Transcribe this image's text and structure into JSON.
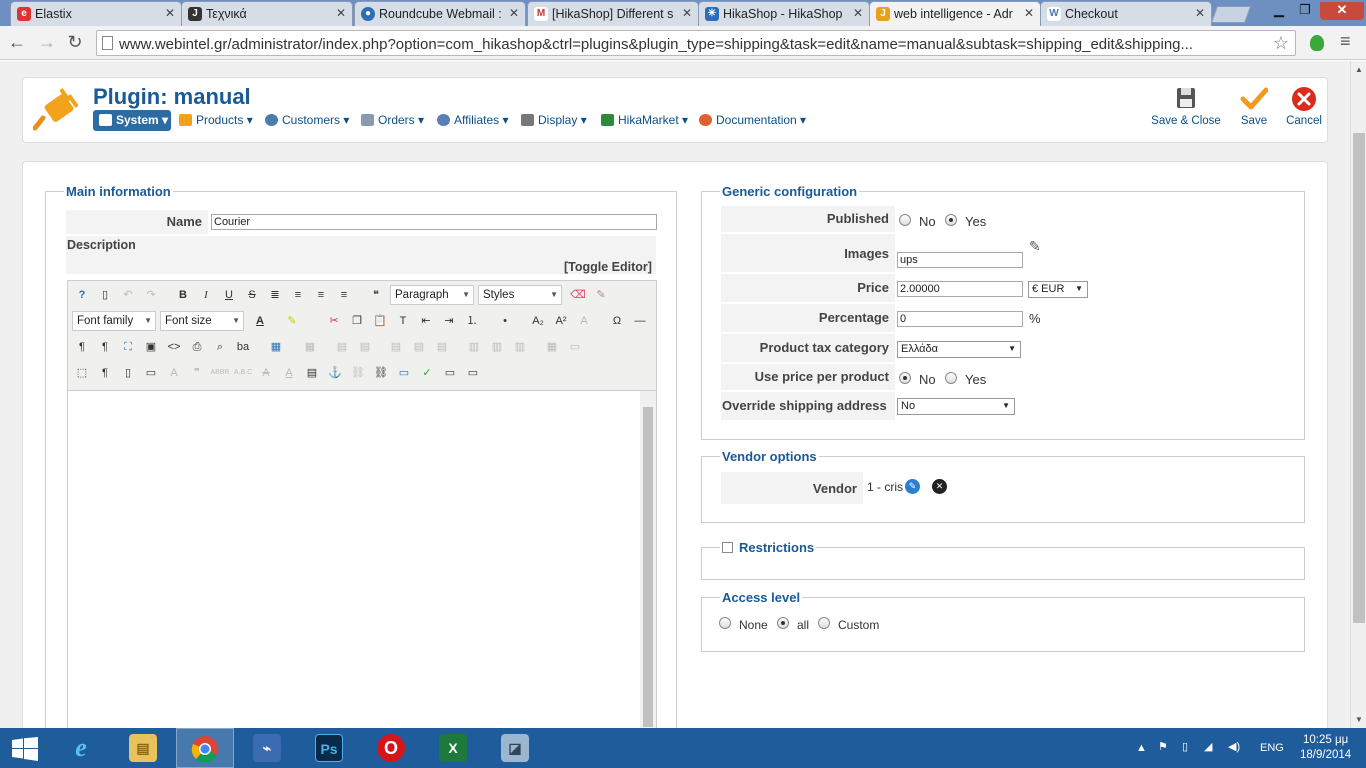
{
  "browser": {
    "tabs": [
      {
        "title": "Elastix",
        "favicon": "elastix-icon",
        "color": "#d33"
      },
      {
        "title": "Τεχνικά",
        "favicon": "joomla-icon",
        "color": "#333"
      },
      {
        "title": "Roundcube Webmail :",
        "favicon": "roundcube-icon",
        "color": "#2a6fb8"
      },
      {
        "title": "[HikaShop] Different s",
        "favicon": "gmail-icon",
        "color": "#c33"
      },
      {
        "title": "HikaShop - HikaShop",
        "favicon": "hikashop-icon",
        "color": "#2a6fb8"
      },
      {
        "title": "web intelligence - Adr",
        "favicon": "joomla-icon",
        "color": "#e8a020"
      },
      {
        "title": "Checkout",
        "favicon": "checkout-icon",
        "color": "#4a7cb0"
      }
    ],
    "url": "www.webintel.gr/administrator/index.php?option=com_hikashop&ctrl=plugins&plugin_type=shipping&task=edit&name=manual&subtask=shipping_edit&shipping..."
  },
  "header": {
    "title": "Plugin: manual",
    "menu": [
      {
        "label": "System",
        "icon": "system-icon",
        "color": "#fff"
      },
      {
        "label": "Products",
        "icon": "products-icon",
        "color": "#f2a21b"
      },
      {
        "label": "Customers",
        "icon": "customers-icon",
        "color": "#4a7cb0"
      },
      {
        "label": "Orders",
        "icon": "orders-icon",
        "color": "#8a9bb0"
      },
      {
        "label": "Affiliates",
        "icon": "affiliates-icon",
        "color": "#5b7fb5"
      },
      {
        "label": "Display",
        "icon": "display-icon",
        "color": "#777"
      },
      {
        "label": "HikaMarket",
        "icon": "hikamarket-icon",
        "color": "#2e8b3a"
      },
      {
        "label": "Documentation",
        "icon": "documentation-icon",
        "color": "#e06030"
      }
    ],
    "actions": {
      "save_close": "Save & Close",
      "save": "Save",
      "cancel": "Cancel"
    }
  },
  "main_info": {
    "legend": "Main information",
    "name_label": "Name",
    "name_value": "Courier",
    "description_label": "Description",
    "toggle_editor": "[Toggle Editor]",
    "editor": {
      "format_select": "Paragraph",
      "styles_select": "Styles",
      "font_family": "Font family",
      "font_size": "Font size"
    }
  },
  "generic": {
    "legend": "Generic configuration",
    "published_label": "Published",
    "published_value": "Yes",
    "no": "No",
    "yes": "Yes",
    "images_label": "Images",
    "images_value": "ups",
    "price_label": "Price",
    "price_value": "2.00000",
    "currency": "€ EUR",
    "percentage_label": "Percentage",
    "percentage_value": "0",
    "percent_sign": "%",
    "tax_label": "Product tax category",
    "tax_value": "Ελλάδα",
    "per_product_label": "Use price per product",
    "per_product_value": "No",
    "override_label": "Override shipping address",
    "override_value": "No"
  },
  "vendor": {
    "legend": "Vendor options",
    "label": "Vendor",
    "value": "1 - cris"
  },
  "restrictions": {
    "legend": "Restrictions",
    "checked": false
  },
  "access": {
    "legend": "Access level",
    "options": [
      "None",
      "all",
      "Custom"
    ],
    "selected": "all"
  },
  "taskbar": {
    "lang": "ENG",
    "time": "10:25 μμ",
    "date": "18/9/2014",
    "apps": [
      {
        "name": "start-button",
        "glyph": "⊞",
        "color": "transparent"
      },
      {
        "name": "ie-icon",
        "glyph": "e",
        "color": "#1e90d6"
      },
      {
        "name": "explorer-icon",
        "glyph": "▤",
        "color": "#e8c25a"
      },
      {
        "name": "chrome-icon",
        "glyph": "●",
        "color": "#d94a38"
      },
      {
        "name": "network-icon",
        "glyph": "⌁",
        "color": "#3b6bb0"
      },
      {
        "name": "photoshop-icon",
        "glyph": "Ps",
        "color": "#0a2a4a"
      },
      {
        "name": "opera-icon",
        "glyph": "O",
        "color": "#d4161c"
      },
      {
        "name": "excel-icon",
        "glyph": "X",
        "color": "#1e7a3a"
      },
      {
        "name": "notes-icon",
        "glyph": "◪",
        "color": "#9bb7d0"
      }
    ]
  }
}
